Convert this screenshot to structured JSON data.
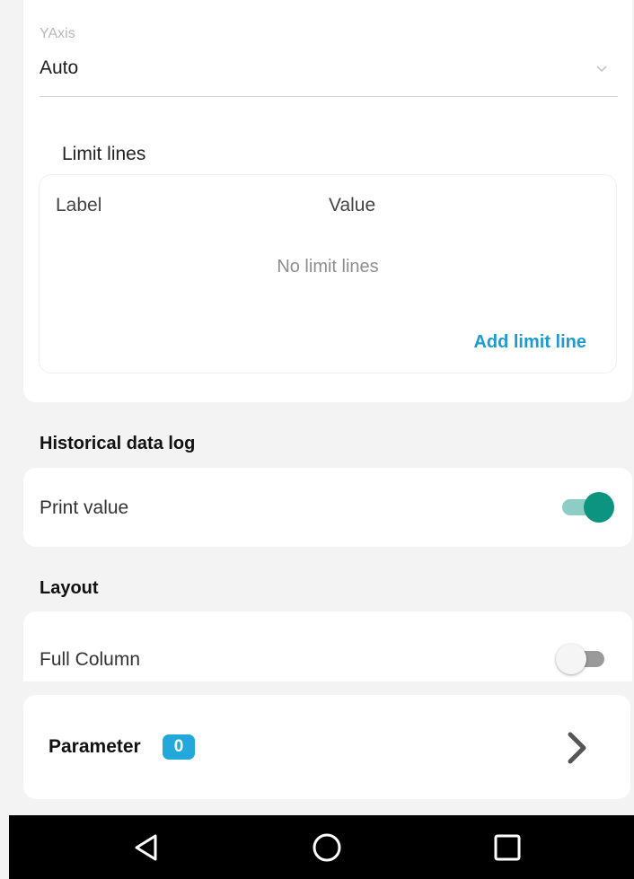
{
  "yaxis": {
    "label": "YAxis",
    "value": "Auto",
    "icon": "chevron-down-icon"
  },
  "limit_lines": {
    "title": "Limit lines",
    "columns": [
      "Label",
      "Value"
    ],
    "empty_text": "No limit lines",
    "add_label": "Add limit line"
  },
  "historical": {
    "title": "Historical data log",
    "print_value": {
      "label": "Print value",
      "enabled": true
    }
  },
  "layout": {
    "title": "Layout",
    "full_column": {
      "label": "Full Column",
      "enabled": false
    }
  },
  "parameter": {
    "label": "Parameter",
    "count": "0",
    "icon": "chevron-right-icon"
  },
  "navbar": {
    "icons": [
      "back-icon",
      "home-icon",
      "recents-icon"
    ]
  },
  "colors": {
    "accent_link": "#1d9bd1",
    "toggle_on": "#0d9480",
    "badge": "#23a8dc",
    "background": "#f3f3f3"
  }
}
